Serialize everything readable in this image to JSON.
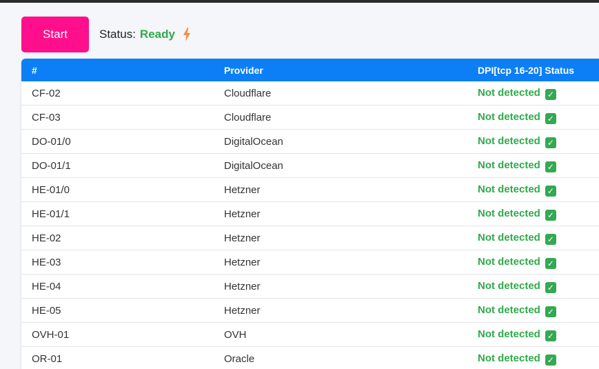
{
  "controls": {
    "start_label": "Start",
    "status_label": "Status:",
    "status_value": "Ready",
    "status_icon": "lightning-bolt-icon"
  },
  "table": {
    "headers": [
      "#",
      "Provider",
      "DPI[tcp 16-20] Status"
    ],
    "rows": [
      {
        "id": "CF-02",
        "provider": "Cloudflare",
        "status": "Not detected"
      },
      {
        "id": "CF-03",
        "provider": "Cloudflare",
        "status": "Not detected"
      },
      {
        "id": "DO-01/0",
        "provider": "DigitalOcean",
        "status": "Not detected"
      },
      {
        "id": "DO-01/1",
        "provider": "DigitalOcean",
        "status": "Not detected"
      },
      {
        "id": "HE-01/0",
        "provider": "Hetzner",
        "status": "Not detected"
      },
      {
        "id": "HE-01/1",
        "provider": "Hetzner",
        "status": "Not detected"
      },
      {
        "id": "HE-02",
        "provider": "Hetzner",
        "status": "Not detected"
      },
      {
        "id": "HE-03",
        "provider": "Hetzner",
        "status": "Not detected"
      },
      {
        "id": "HE-04",
        "provider": "Hetzner",
        "status": "Not detected"
      },
      {
        "id": "HE-05",
        "provider": "Hetzner",
        "status": "Not detected"
      },
      {
        "id": "OVH-01",
        "provider": "OVH",
        "status": "Not detected"
      },
      {
        "id": "OR-01",
        "provider": "Oracle",
        "status": "Not detected"
      }
    ],
    "status_icon": "check-mark-icon"
  },
  "colors": {
    "start_button": "#ff0f8c",
    "header_bg": "#0d7ff6",
    "ok_text": "#2faa4a",
    "check_bg": "#34a853",
    "bolt": "#f58a3a"
  }
}
